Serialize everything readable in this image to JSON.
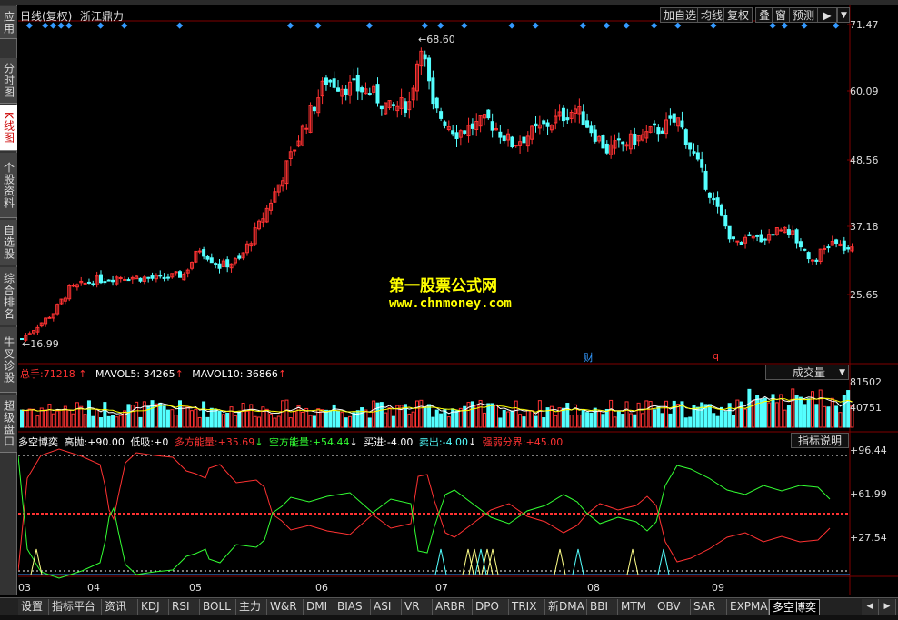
{
  "sidebar": {
    "items": [
      {
        "label": "应用"
      },
      {
        "label": "分时图"
      },
      {
        "label": "K线图",
        "active": true
      },
      {
        "label": "个股资料"
      },
      {
        "label": "自选股"
      },
      {
        "label": "综合排名"
      },
      {
        "label": "牛叉诊股"
      },
      {
        "label": "超级盘口"
      }
    ]
  },
  "header": {
    "period": "日线(复权)",
    "stock_name": "浙江鼎力"
  },
  "toolbar": {
    "buttons": [
      "加自选",
      "均线",
      "复权",
      "叠",
      "窗",
      "预测"
    ]
  },
  "price_axis": {
    "labels": [
      "71.47",
      "60.09",
      "48.56",
      "37.18",
      "25.65"
    ]
  },
  "price_annotations": {
    "high": "68.60",
    "low": "16.99",
    "marker1": "财",
    "marker2": "q"
  },
  "volume_panel": {
    "label_total": "总手:",
    "value_total": "71218",
    "label_ma5": "MAVOL5:",
    "value_ma5": "34265",
    "label_ma10": "MAVOL10:",
    "value_ma10": "36866",
    "selector": "成交量",
    "axis": [
      "81502",
      "40751"
    ]
  },
  "indicator_panel": {
    "name": "多空博奕",
    "items": [
      {
        "label": "高抛:",
        "value": "+90.00"
      },
      {
        "label": "低吸:",
        "value": "+0"
      },
      {
        "label": "多方能量:",
        "value": "+35.69"
      },
      {
        "label": "空方能量:",
        "value": "+54.44"
      },
      {
        "label": "买进:",
        "value": "-4.00"
      },
      {
        "label": "卖出:",
        "value": "-4.00"
      },
      {
        "label": "强弱分界:",
        "value": "+45.00"
      }
    ],
    "help_button": "指标说明",
    "axis": [
      "+96.44",
      "+61.99",
      "+27.54"
    ]
  },
  "date_axis": {
    "labels": [
      "03",
      "04",
      "05",
      "06",
      "07",
      "08",
      "09"
    ]
  },
  "watermark": {
    "line1": "第一股票公式网",
    "line2": "www.chnmoney.com"
  },
  "bottom_tabs": [
    "设置",
    "指标平台",
    "资讯",
    "KDJ",
    "RSI",
    "BOLL",
    "主力",
    "W&R",
    "DMI",
    "BIAS",
    "ASI",
    "VR",
    "ARBR",
    "DPO",
    "TRIX",
    "新DMA",
    "BBI",
    "MTM",
    "OBV",
    "SAR",
    "EXPMA",
    "多空博奕"
  ],
  "active_tab": "多空博奕",
  "colors": {
    "up": "#ff3232",
    "down": "#54ffff",
    "ma5": "#ffffff",
    "ma10": "#ffff00",
    "bull": "#ff3232",
    "bear": "#33ff33",
    "grid": "#800000",
    "diamond": "#3399ff"
  }
}
